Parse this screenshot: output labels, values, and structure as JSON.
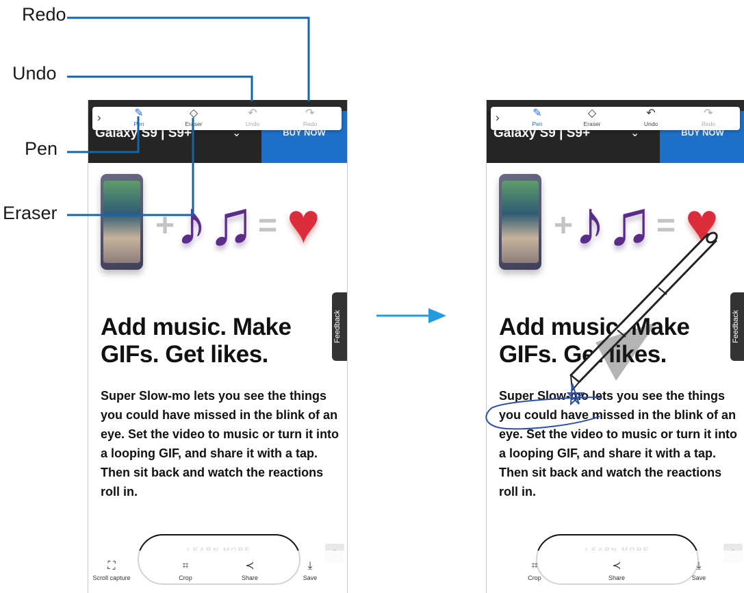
{
  "callouts": {
    "redo": "Redo",
    "undo": "Undo",
    "pen": "Pen",
    "eraser": "Eraser"
  },
  "toolbar": {
    "pen": "Pen",
    "eraser": "Eraser",
    "undo": "Undo",
    "redo": "Redo"
  },
  "page": {
    "brand": "Galaxy S9 | S9+",
    "buy_now": "BUY NOW",
    "headline": "Add music. Make GIFs. Get likes.",
    "paragraph": "Super Slow-mo lets you see the things you could have missed in the blink of an eye. Set the video to music or turn it into a looping GIF, and share it with a tap. Then sit back and watch the reactions roll in.",
    "feedback": "Feedback",
    "learn_more": "LEARN MORE"
  },
  "bottombar_left": {
    "scroll_capture": "Scroll capture",
    "crop": "Crop",
    "share": "Share",
    "save": "Save"
  },
  "bottombar_right": {
    "crop": "Crop",
    "share": "Share",
    "save": "Save"
  },
  "colors": {
    "accent": "#1f6ed4",
    "callout_line": "#1565a8",
    "buy_button": "#1d6fc7",
    "arrow": "#1f9de0",
    "ink": "#2a4fa8"
  },
  "icons": {
    "pen": "pen-icon",
    "eraser": "eraser-icon",
    "undo": "undo-icon",
    "redo": "redo-icon",
    "scroll_capture": "scroll-capture-icon",
    "crop": "crop-icon",
    "share": "share-icon",
    "save": "save-icon"
  }
}
